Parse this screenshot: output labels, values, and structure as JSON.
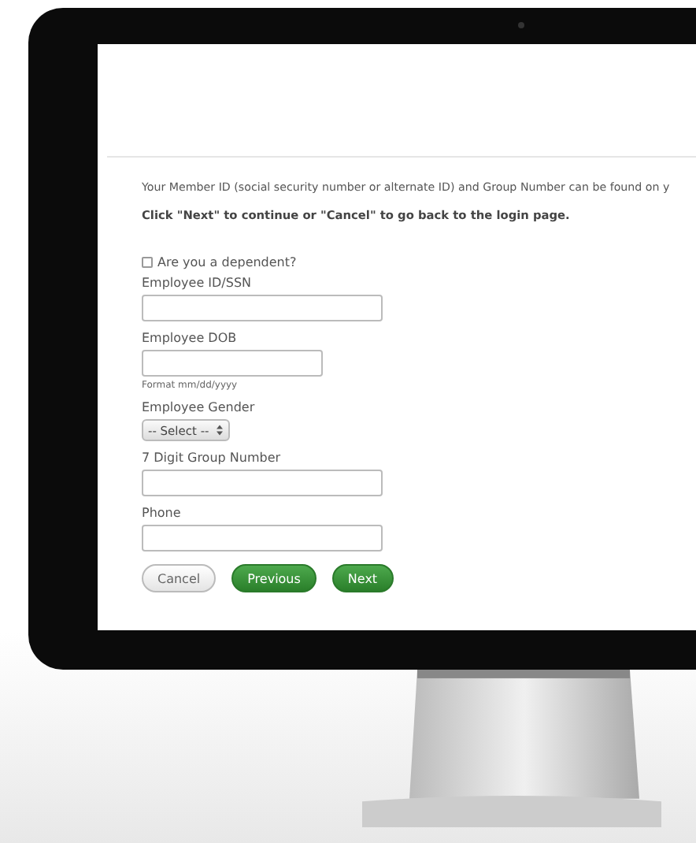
{
  "intro": "Your Member ID (social security number or alternate ID) and Group Number can be found on y",
  "instruction": "Click \"Next\" to continue or \"Cancel\" to go back to the login page.",
  "dependent": {
    "label": "Are you a dependent?",
    "checked": false
  },
  "fields": [
    {
      "kind": "text",
      "label": "Employee ID/SSN"
    },
    {
      "kind": "date",
      "label": "Employee DOB",
      "hint": "Format mm/dd/yyyy"
    },
    {
      "kind": "select",
      "label": "Employee Gender",
      "value": "-- Select --"
    },
    {
      "kind": "text",
      "label": "7 Digit Group Number"
    },
    {
      "kind": "text",
      "label": "Phone"
    }
  ],
  "buttons": [
    {
      "kind": "secondary",
      "label": "Cancel"
    },
    {
      "kind": "primary",
      "label": "Previous"
    },
    {
      "kind": "primary",
      "label": "Next"
    }
  ]
}
